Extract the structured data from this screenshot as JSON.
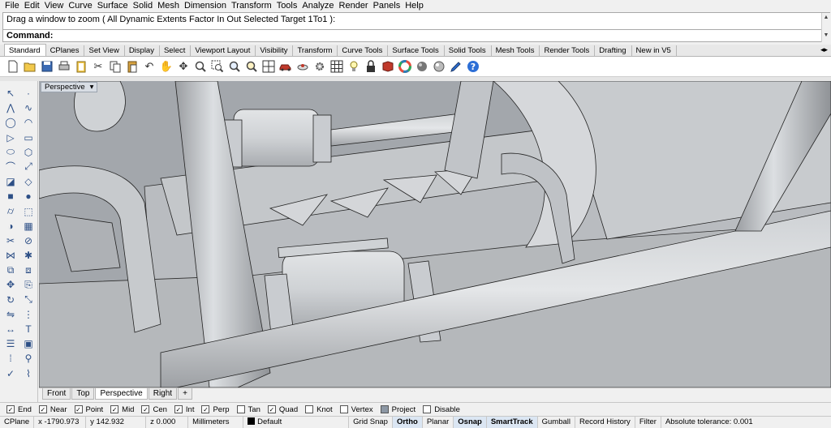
{
  "menu": [
    "File",
    "Edit",
    "View",
    "Curve",
    "Surface",
    "Solid",
    "Mesh",
    "Dimension",
    "Transform",
    "Tools",
    "Analyze",
    "Render",
    "Panels",
    "Help"
  ],
  "command": {
    "history": "Drag a window to zoom ( All  Dynamic  Extents  Factor  In  Out  Selected  Target  1To1 ):",
    "prompt": "Command:"
  },
  "tabs": [
    "Standard",
    "CPlanes",
    "Set View",
    "Display",
    "Select",
    "Viewport Layout",
    "Visibility",
    "Transform",
    "Curve Tools",
    "Surface Tools",
    "Solid Tools",
    "Mesh Tools",
    "Render Tools",
    "Drafting",
    "New in V5"
  ],
  "toolbar_icons": [
    "new-icon",
    "open-icon",
    "save-icon",
    "print-icon",
    "clipboard-icon",
    "cut-icon",
    "copy-icon",
    "paste-icon",
    "undo-icon",
    "pan-hand-icon",
    "rotate-view-icon",
    "zoom-icon",
    "zoom-window-icon",
    "zoom-extents-icon",
    "zoom-selected-icon",
    "four-viewports-icon",
    "car-icon",
    "rotate-object-icon",
    "gear-icon",
    "grid-icon",
    "lightbulb-icon",
    "lock-icon",
    "shade-icon",
    "color-wheel-icon",
    "sphere-icon",
    "render-sphere-icon",
    "properties-icon",
    "help-icon"
  ],
  "left_tools": [
    "select-arrow-icon",
    "point-icon",
    "polyline-icon",
    "curve-icon",
    "circle-icon",
    "arc-icon",
    "triangle-icon",
    "rectangle-icon",
    "ellipse-icon",
    "polygon-icon",
    "fillet-curve-icon",
    "extend-icon",
    "surface-icon",
    "loft-icon",
    "box-icon",
    "sphere-solid-icon",
    "cylinder-icon",
    "extrude-icon",
    "boolean-icon",
    "mesh-icon",
    "trim-icon",
    "split-icon",
    "join-icon",
    "explode-icon",
    "group-icon",
    "ungroup-icon",
    "move-icon",
    "copy-object-icon",
    "rotate-icon",
    "scale-icon",
    "mirror-icon",
    "array-icon",
    "dimension-icon",
    "text-icon",
    "layer-icon",
    "block-icon",
    "grid-dots-icon",
    "analyze-icon",
    "check-icon",
    "curvature-icon"
  ],
  "viewport": {
    "title": "Perspective",
    "tabs": [
      "Front",
      "Top",
      "Perspective",
      "Right"
    ],
    "active_tab": "Perspective",
    "add_tab": "+"
  },
  "osnap": [
    {
      "label": "End",
      "checked": true
    },
    {
      "label": "Near",
      "checked": true
    },
    {
      "label": "Point",
      "checked": true
    },
    {
      "label": "Mid",
      "checked": true
    },
    {
      "label": "Cen",
      "checked": true
    },
    {
      "label": "Int",
      "checked": true
    },
    {
      "label": "Perp",
      "checked": true
    },
    {
      "label": "Tan",
      "checked": false
    },
    {
      "label": "Quad",
      "checked": true
    },
    {
      "label": "Knot",
      "checked": false
    },
    {
      "label": "Vertex",
      "checked": false
    },
    {
      "label": "Project",
      "checked": false
    },
    {
      "label": "Disable",
      "checked": false
    }
  ],
  "status": {
    "cplane": "CPlane",
    "x": "x -1790.973",
    "y": "y 142.932",
    "z": "z 0.000",
    "units": "Millimeters",
    "layer": "Default",
    "grid_snap": "Grid Snap",
    "ortho": "Ortho",
    "planar": "Planar",
    "osnap": "Osnap",
    "smarttrack": "SmartTrack",
    "gumball": "Gumball",
    "record_history": "Record History",
    "filter": "Filter",
    "tolerance": "Absolute tolerance: 0.001"
  }
}
